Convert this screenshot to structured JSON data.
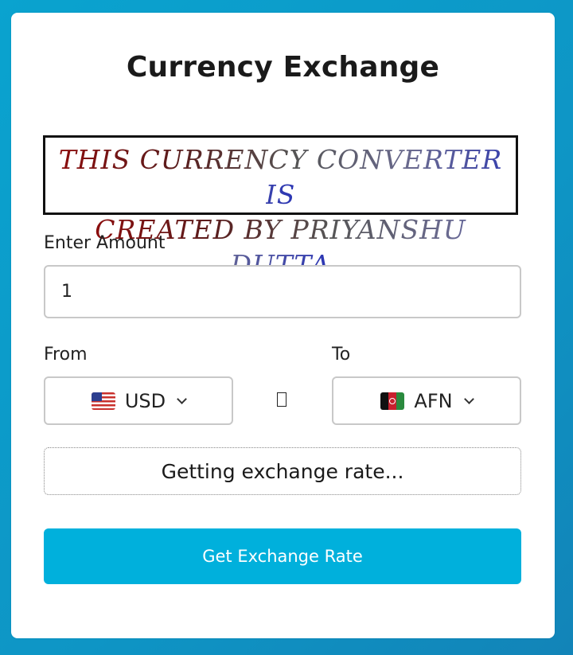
{
  "app": {
    "title": "Currency Exchange",
    "banner_line1": "THIS CURRENCY CONVERTER IS",
    "banner_line2": "CREATED BY PRIYANSHU DUTTA"
  },
  "form": {
    "amount_label": "Enter Amount",
    "amount_value": "1",
    "from_label": "From",
    "to_label": "To",
    "from_currency": "USD",
    "to_currency": "AFN",
    "from_flag_icon": "us-flag-icon",
    "to_flag_icon": "afghanistan-flag-icon",
    "swap_icon": "⇄",
    "status_text": "Getting exchange rate...",
    "button_label": "Get Exchange Rate"
  },
  "colors": {
    "background": "#0ea0cc",
    "button": "#00b0dc",
    "banner_start": "#8b0d0d",
    "banner_end": "#2a35b5"
  }
}
